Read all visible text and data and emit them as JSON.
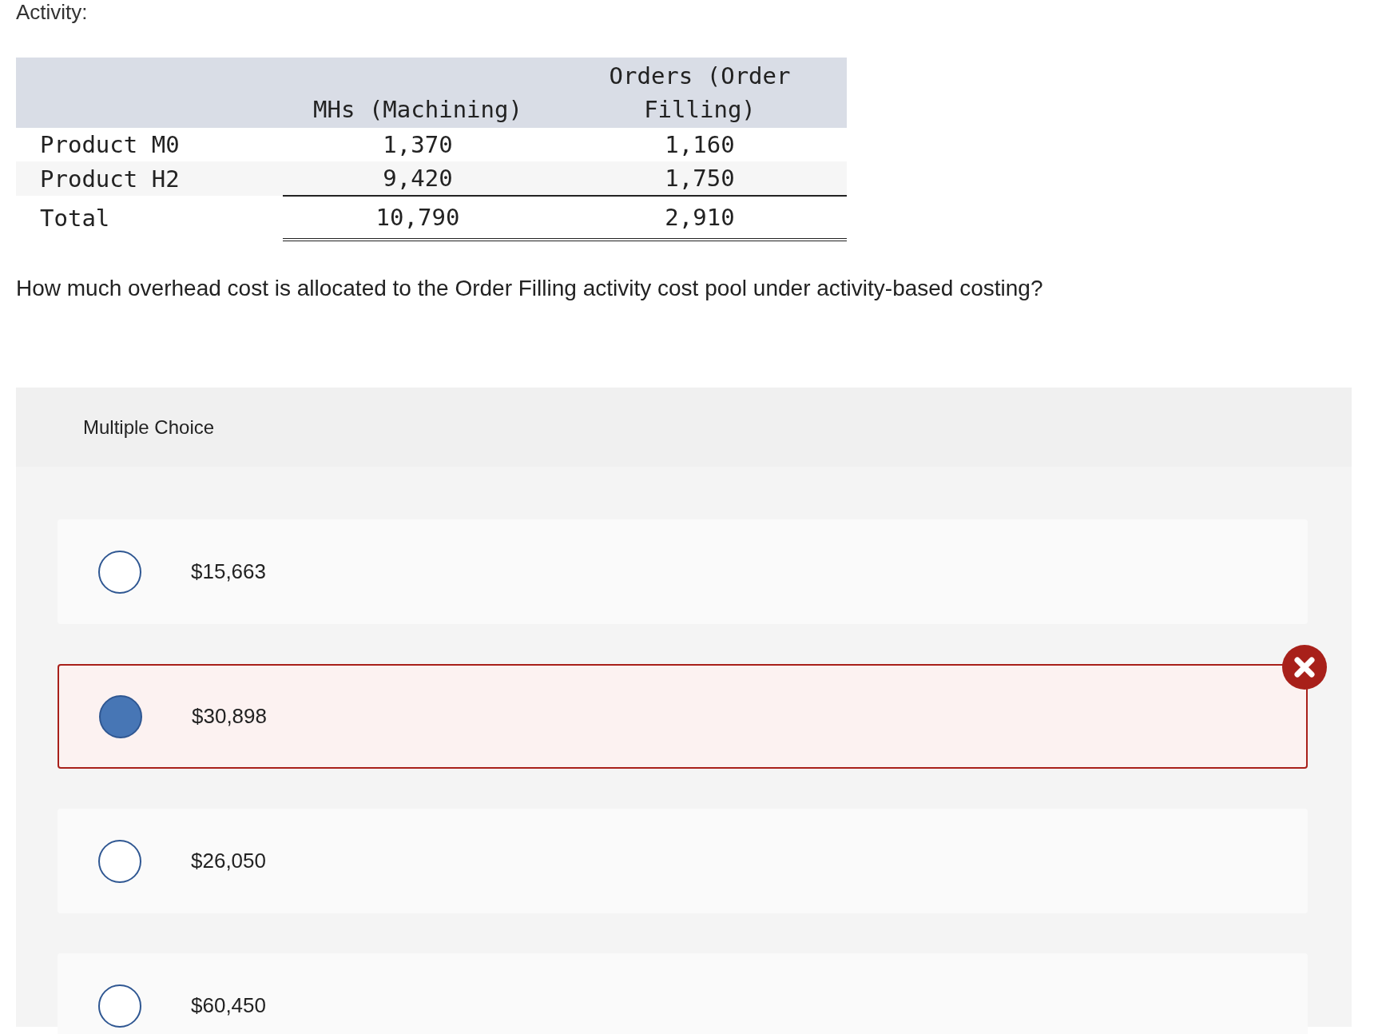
{
  "intro_label": "Activity:",
  "table": {
    "columns": [
      "",
      "MHs (Machining)",
      "Orders (Order Filling)"
    ],
    "rows": [
      {
        "kind": "item",
        "cells": [
          "Product M0",
          "1,370",
          "1,160"
        ]
      },
      {
        "kind": "item",
        "cells": [
          "Product H2",
          "9,420",
          "1,750"
        ]
      },
      {
        "kind": "total",
        "cells": [
          "Total",
          "10,790",
          "2,910"
        ]
      }
    ]
  },
  "question": "How much overhead cost is allocated to the Order Filling activity cost pool under activity-based costing?",
  "multiple_choice": {
    "heading": "Multiple Choice",
    "options": [
      {
        "label": "$15,663",
        "selected": false,
        "incorrect": false
      },
      {
        "label": "$30,898",
        "selected": true,
        "incorrect": true
      },
      {
        "label": "$26,050",
        "selected": false,
        "incorrect": false
      },
      {
        "label": "$60,450",
        "selected": false,
        "incorrect": false
      }
    ]
  }
}
